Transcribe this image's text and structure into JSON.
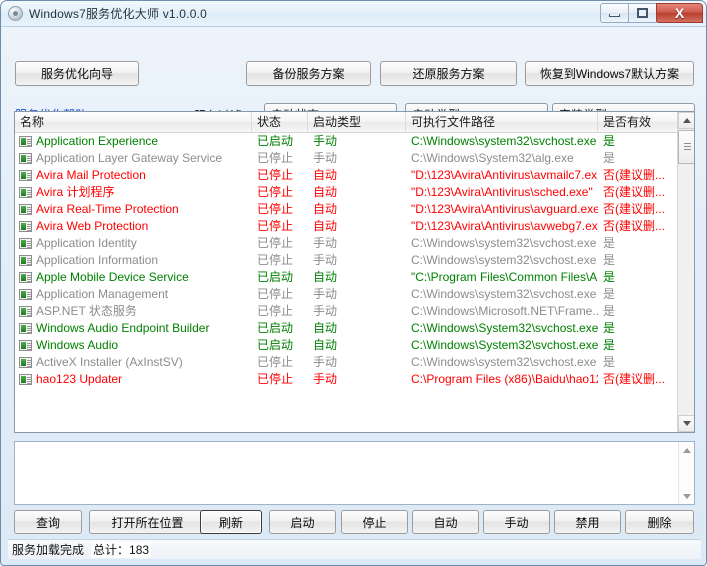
{
  "window": {
    "title": "Windows7服务优化大师 v1.0.0.0",
    "icon": "gear-disc-icon",
    "controls": {
      "minimize": "—",
      "maximize": "□",
      "close": "X"
    }
  },
  "toolbar": {
    "wizard": "服务优化向导",
    "backup": "备份服务方案",
    "restore": "还原服务方案",
    "default_scheme": "恢复到Windows7默认方案",
    "help_link": "服务优化帮助",
    "filter_label": "服务过滤",
    "filters": [
      {
        "name": "启动状态"
      },
      {
        "name": "启动类型"
      },
      {
        "name": "安装类型"
      }
    ]
  },
  "list": {
    "columns": [
      "名称",
      "状态",
      "启动类型",
      "可执行文件路径",
      "是否有效"
    ],
    "rows": [
      {
        "name": "Application Experience",
        "state": "已启动",
        "type": "手动",
        "path": "C:\\Windows\\system32\\svchost.exe ...",
        "valid": "是",
        "color": "green"
      },
      {
        "name": "Application Layer Gateway Service",
        "state": "已停止",
        "type": "手动",
        "path": "C:\\Windows\\System32\\alg.exe",
        "valid": "是",
        "color": "gray"
      },
      {
        "name": "Avira Mail Protection",
        "state": "已停止",
        "type": "自动",
        "path": "\"D:\\123\\Avira\\Antivirus\\avmailc7.ex...",
        "valid": "否(建议删...",
        "color": "red"
      },
      {
        "name": "Avira 计划程序",
        "state": "已停止",
        "type": "自动",
        "path": "\"D:\\123\\Avira\\Antivirus\\sched.exe\"",
        "valid": "否(建议删...",
        "color": "red"
      },
      {
        "name": "Avira Real-Time Protection",
        "state": "已停止",
        "type": "自动",
        "path": "\"D:\\123\\Avira\\Antivirus\\avguard.exe\"",
        "valid": "否(建议删...",
        "color": "red"
      },
      {
        "name": "Avira Web Protection",
        "state": "已停止",
        "type": "自动",
        "path": "\"D:\\123\\Avira\\Antivirus\\avwebg7.ex...",
        "valid": "否(建议删...",
        "color": "red"
      },
      {
        "name": "Application Identity",
        "state": "已停止",
        "type": "手动",
        "path": "C:\\Windows\\system32\\svchost.exe ...",
        "valid": "是",
        "color": "gray"
      },
      {
        "name": "Application Information",
        "state": "已停止",
        "type": "手动",
        "path": "C:\\Windows\\system32\\svchost.exe ...",
        "valid": "是",
        "color": "gray"
      },
      {
        "name": "Apple Mobile Device Service",
        "state": "已启动",
        "type": "自动",
        "path": "\"C:\\Program Files\\Common Files\\A...",
        "valid": "是",
        "color": "green"
      },
      {
        "name": "Application Management",
        "state": "已停止",
        "type": "手动",
        "path": "C:\\Windows\\system32\\svchost.exe ...",
        "valid": "是",
        "color": "gray"
      },
      {
        "name": "ASP.NET 状态服务",
        "state": "已停止",
        "type": "手动",
        "path": "C:\\Windows\\Microsoft.NET\\Frame...",
        "valid": "是",
        "color": "gray"
      },
      {
        "name": "Windows Audio Endpoint Builder",
        "state": "已启动",
        "type": "自动",
        "path": "C:\\Windows\\System32\\svchost.exe ...",
        "valid": "是",
        "color": "green"
      },
      {
        "name": "Windows Audio",
        "state": "已启动",
        "type": "自动",
        "path": "C:\\Windows\\System32\\svchost.exe ...",
        "valid": "是",
        "color": "green"
      },
      {
        "name": "ActiveX Installer (AxInstSV)",
        "state": "已停止",
        "type": "手动",
        "path": "C:\\Windows\\system32\\svchost.exe ...",
        "valid": "是",
        "color": "gray"
      },
      {
        "name": "hao123 Updater",
        "state": "已停止",
        "type": "手动",
        "path": "C:\\Program Files (x86)\\Baidu\\hao12...",
        "valid": "否(建议删...",
        "color": "red"
      }
    ]
  },
  "log": {
    "text": ""
  },
  "actions": {
    "query": "查询",
    "open_location": "打开所在位置",
    "refresh": "刷新",
    "start": "启动",
    "stop": "停止",
    "auto": "自动",
    "manual": "手动",
    "disable": "禁用",
    "delete": "删除"
  },
  "status": {
    "message": "服务加载完成",
    "total": "总计：183"
  },
  "colors": {
    "green": "#008000",
    "red": "#ff0000",
    "gray": "#8c8c8c",
    "link": "#1a4fd6",
    "title_text": "#1c2c3c"
  }
}
